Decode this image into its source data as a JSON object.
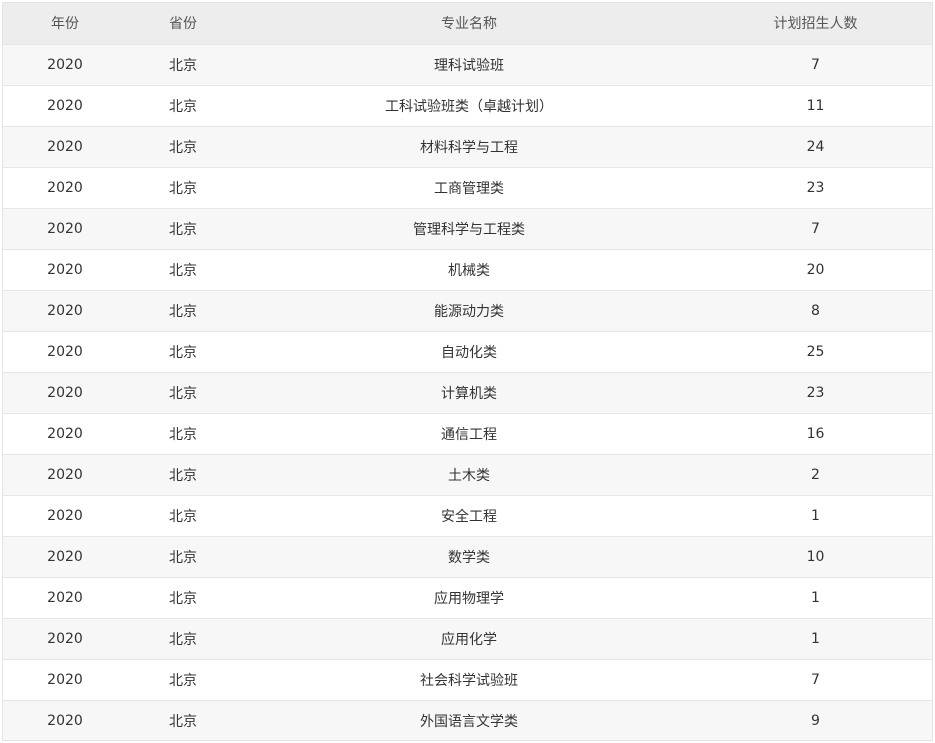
{
  "table": {
    "headers": {
      "year": "年份",
      "province": "省份",
      "major": "专业名称",
      "count": "计划招生人数"
    },
    "rows": [
      {
        "year": "2020",
        "province": "北京",
        "major": "理科试验班",
        "count": "7"
      },
      {
        "year": "2020",
        "province": "北京",
        "major": "工科试验班类（卓越计划）",
        "count": "11"
      },
      {
        "year": "2020",
        "province": "北京",
        "major": "材料科学与工程",
        "count": "24"
      },
      {
        "year": "2020",
        "province": "北京",
        "major": "工商管理类",
        "count": "23"
      },
      {
        "year": "2020",
        "province": "北京",
        "major": "管理科学与工程类",
        "count": "7"
      },
      {
        "year": "2020",
        "province": "北京",
        "major": "机械类",
        "count": "20"
      },
      {
        "year": "2020",
        "province": "北京",
        "major": "能源动力类",
        "count": "8"
      },
      {
        "year": "2020",
        "province": "北京",
        "major": "自动化类",
        "count": "25"
      },
      {
        "year": "2020",
        "province": "北京",
        "major": "计算机类",
        "count": "23"
      },
      {
        "year": "2020",
        "province": "北京",
        "major": "通信工程",
        "count": "16"
      },
      {
        "year": "2020",
        "province": "北京",
        "major": "土木类",
        "count": "2"
      },
      {
        "year": "2020",
        "province": "北京",
        "major": "安全工程",
        "count": "1"
      },
      {
        "year": "2020",
        "province": "北京",
        "major": "数学类",
        "count": "10"
      },
      {
        "year": "2020",
        "province": "北京",
        "major": "应用物理学",
        "count": "1"
      },
      {
        "year": "2020",
        "province": "北京",
        "major": "应用化学",
        "count": "1"
      },
      {
        "year": "2020",
        "province": "北京",
        "major": "社会科学试验班",
        "count": "7"
      },
      {
        "year": "2020",
        "province": "北京",
        "major": "外国语言文学类",
        "count": "9"
      }
    ]
  }
}
